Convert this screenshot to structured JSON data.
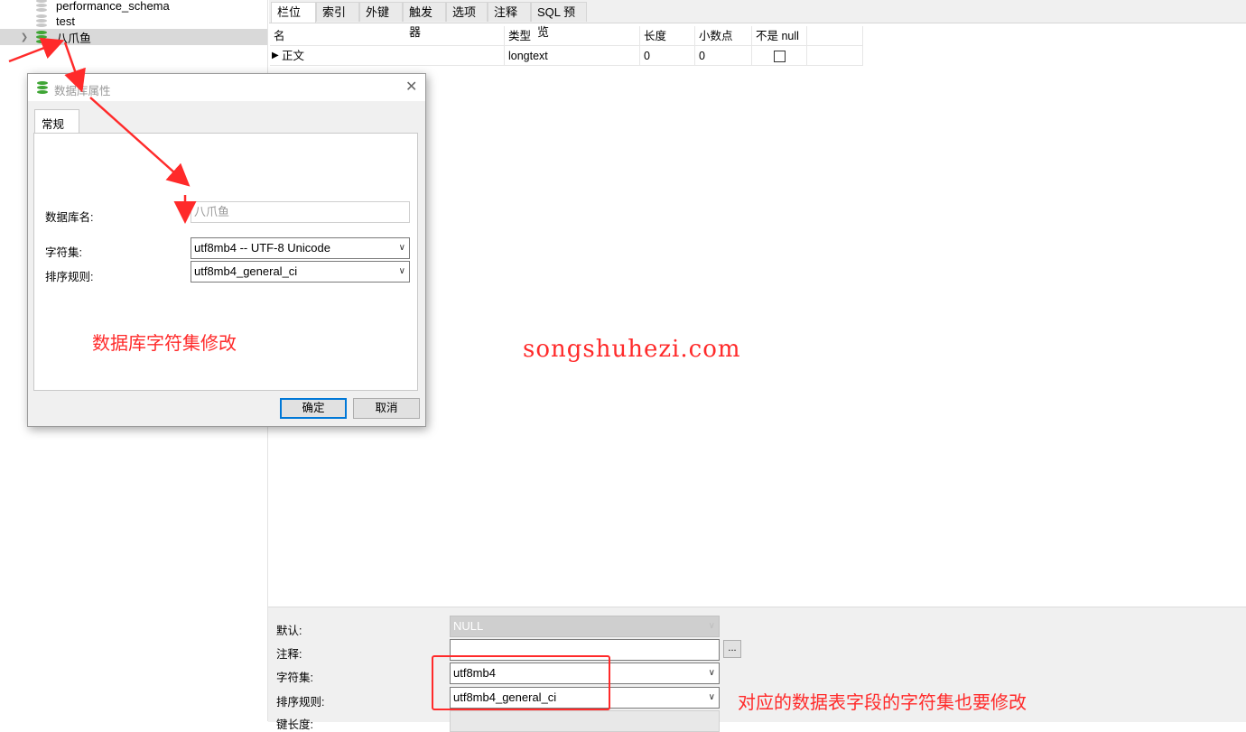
{
  "tree": {
    "items": [
      {
        "label": "performance_schema",
        "icon": "database-icon"
      },
      {
        "label": "test",
        "icon": "database-icon"
      },
      {
        "label": "八爪鱼",
        "icon": "database-icon",
        "selected": true
      }
    ]
  },
  "tabs": [
    "栏位",
    "索引",
    "外键",
    "触发器",
    "选项",
    "注释",
    "SQL 预览"
  ],
  "grid": {
    "headers": [
      "名",
      "类型",
      "长度",
      "小数点",
      "不是 null"
    ],
    "rows": [
      {
        "name": "正文",
        "type": "longtext",
        "length": "0",
        "decimals": "0",
        "not_null": false
      }
    ]
  },
  "dialog": {
    "title": "数据库属性",
    "tab": "常规",
    "db_name_label": "数据库名:",
    "db_name_value": "八爪鱼",
    "charset_label": "字符集:",
    "charset_value": "utf8mb4 -- UTF-8 Unicode",
    "collation_label": "排序规则:",
    "collation_value": "utf8mb4_general_ci",
    "ok_label": "确定",
    "cancel_label": "取消"
  },
  "props": {
    "default_label": "默认:",
    "default_value": "NULL",
    "comment_label": "注释:",
    "comment_btn": "...",
    "charset_label": "字符集:",
    "charset_value": "utf8mb4",
    "collation_label": "排序规则:",
    "collation_value": "utf8mb4_general_ci",
    "keylen_label": "键长度:"
  },
  "annotations": {
    "dialog_note": "数据库字符集修改",
    "watermark": "songshuhezi.com",
    "field_note": "对应的数据表字段的字符集也要修改"
  },
  "colors": {
    "accent": "#0078d7",
    "annotation_red": "#ff2a2a",
    "db_green": "#3fa535",
    "db_gray": "#c8c8c8"
  }
}
